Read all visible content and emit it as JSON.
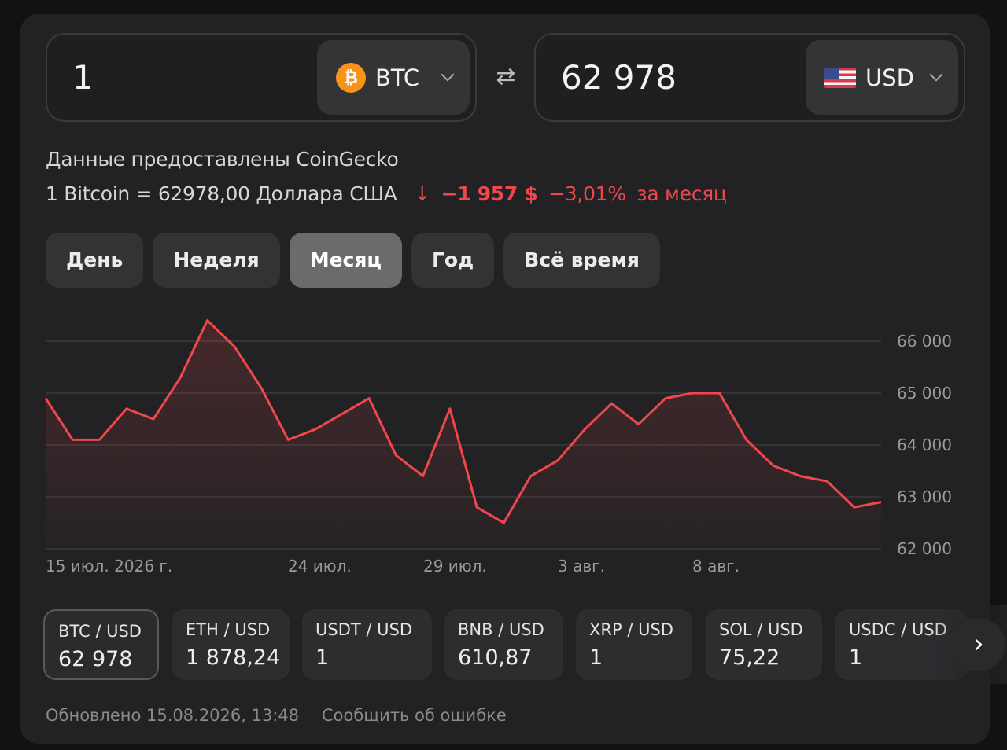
{
  "converter": {
    "from": {
      "amount": "1",
      "currency": "BTC",
      "icon": "bitcoin-icon"
    },
    "to": {
      "amount": "62 978",
      "currency": "USD",
      "icon": "us-flag-icon"
    },
    "swap_icon": "swap-arrows-icon"
  },
  "info": {
    "source": "Данные предоставлены CoinGecko",
    "rate": "1 Bitcoin = 62978,00 Доллара США",
    "change_arrow": "↓",
    "change_abs": "−1 957 $",
    "change_pct": "−3,01%",
    "period_text": "за месяц",
    "negative_color": "#f0474c"
  },
  "tabs": [
    {
      "label": "День",
      "active": false
    },
    {
      "label": "Неделя",
      "active": false
    },
    {
      "label": "Месяц",
      "active": true
    },
    {
      "label": "Год",
      "active": false
    },
    {
      "label": "Всё время",
      "active": false
    }
  ],
  "chart_data": {
    "type": "area",
    "x_labels": [
      "15 июл. 2026 г.",
      "24 июл.",
      "29 июл.",
      "3 авг.",
      "8 авг."
    ],
    "y_ticks": [
      "66 000",
      "65 000",
      "64 000",
      "63 000",
      "62 000"
    ],
    "ylim": [
      62000,
      66000
    ],
    "grid": true,
    "line_color": "#f0474c",
    "values": [
      64900,
      64100,
      64100,
      64700,
      64500,
      65300,
      66400,
      65900,
      65100,
      64100,
      64300,
      64600,
      64900,
      63800,
      63400,
      64700,
      62800,
      62500,
      63400,
      63700,
      64300,
      64800,
      64400,
      64900,
      65000,
      65000,
      64100,
      63600,
      63400,
      63300,
      62800,
      62900
    ]
  },
  "pairs": [
    {
      "name": "BTC / USD",
      "value": "62 978",
      "active": true
    },
    {
      "name": "ETH / USD",
      "value": "1 878,24",
      "active": false
    },
    {
      "name": "USDT / USD",
      "value": "1",
      "active": false
    },
    {
      "name": "BNB / USD",
      "value": "610,87",
      "active": false
    },
    {
      "name": "XRP / USD",
      "value": "1",
      "active": false
    },
    {
      "name": "SOL / USD",
      "value": "75,22",
      "active": false
    },
    {
      "name": "USDC / USD",
      "value": "1",
      "active": false
    }
  ],
  "next_icon": "chevron-right-icon",
  "footer": {
    "updated": "Обновлено 15.08.2026, 13:48",
    "report": "Сообщить об ошибке"
  }
}
